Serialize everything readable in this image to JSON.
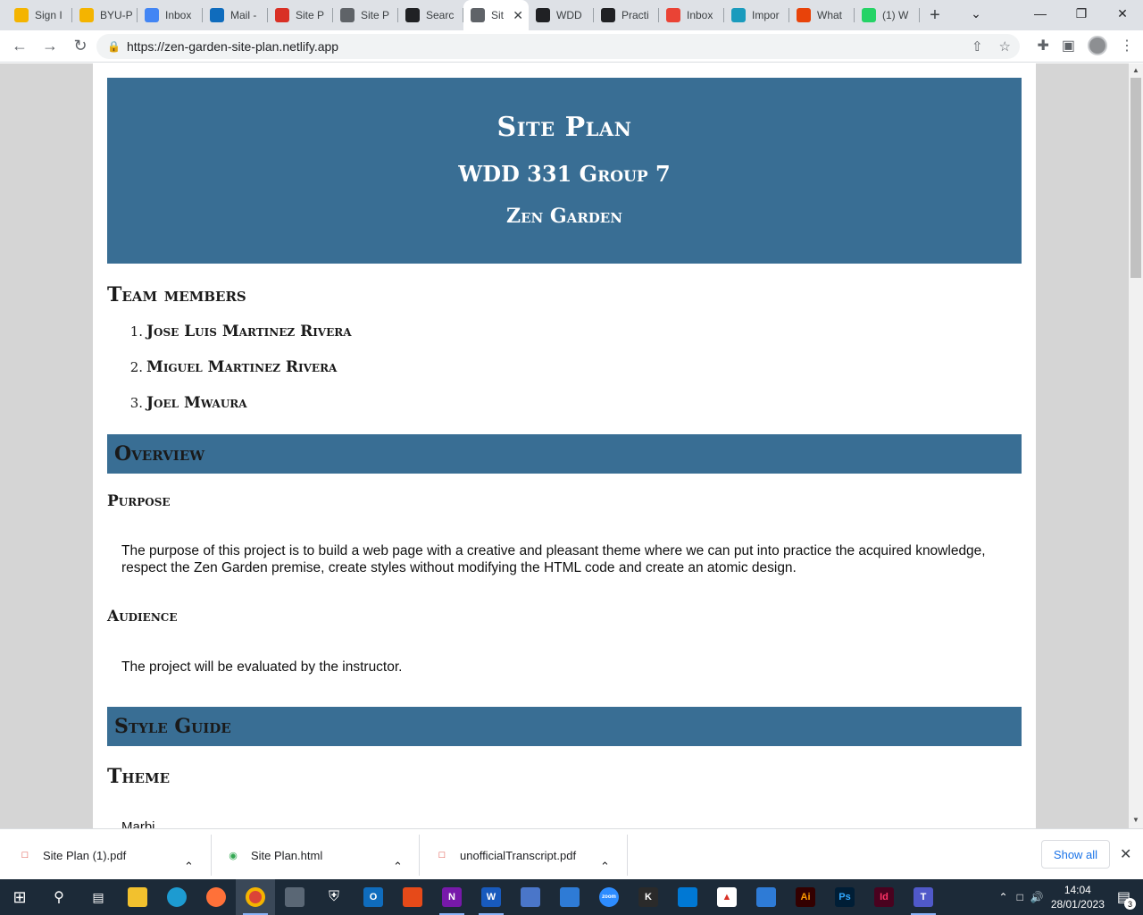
{
  "browser": {
    "tabs": [
      {
        "label": "Sign I",
        "icon": "sign-in-icon",
        "color": "#f4b400"
      },
      {
        "label": "BYU-P",
        "icon": "byu-icon",
        "color": "#f4b400"
      },
      {
        "label": "Inbox",
        "icon": "inbox-icon",
        "color": "#4285f4"
      },
      {
        "label": "Mail -",
        "icon": "outlook-icon",
        "color": "#0f6cbd"
      },
      {
        "label": "Site P",
        "icon": "pdf-icon",
        "color": "#d93025"
      },
      {
        "label": "Site P",
        "icon": "globe-icon",
        "color": "#5f6368"
      },
      {
        "label": "Searc",
        "icon": "github-icon",
        "color": "#202124"
      },
      {
        "label": "Sit",
        "icon": "globe-icon",
        "color": "#5f6368",
        "active": true
      },
      {
        "label": "WDD",
        "icon": "github-icon",
        "color": "#202124"
      },
      {
        "label": "Practi",
        "icon": "github-icon",
        "color": "#202124"
      },
      {
        "label": "Inbox",
        "icon": "gmail-icon",
        "color": "#ea4335"
      },
      {
        "label": "Impor",
        "icon": "diamond-icon",
        "color": "#1a9bbd"
      },
      {
        "label": "What",
        "icon": "alert-icon",
        "color": "#e8430a"
      },
      {
        "label": "(1) W",
        "icon": "whatsapp-icon",
        "color": "#25d366"
      }
    ],
    "url": "https://zen-garden-site-plan.netlify.app"
  },
  "site": {
    "title": "Site Plan",
    "subtitle": "WDD 331 Group 7",
    "project": "Zen Garden",
    "team_heading": "Team members",
    "team": [
      {
        "num": "1.",
        "name": "Jose Luis Martinez Rivera"
      },
      {
        "num": "2.",
        "name": "Miguel Martinez Rivera"
      },
      {
        "num": "3.",
        "name": "Joel Mwaura"
      }
    ],
    "overview_heading": "Overview",
    "purpose_heading": "Purpose",
    "purpose_text": "The purpose of this project is to build a web page with a creative and pleasant theme where we can put into practice the acquired knowledge, respect the Zen Garden premise, create styles without modifying the HTML code and create an atomic design.",
    "audience_heading": "Audience",
    "audience_text": "The project will be evaluated by the instructor.",
    "style_heading": "Style Guide",
    "theme_heading": "Theme",
    "cut_text": "Marbi..."
  },
  "downloads": {
    "items": [
      "Site Plan (1).pdf",
      "Site Plan.html",
      "unofficialTranscript.pdf"
    ],
    "show_all": "Show all"
  },
  "taskbar": {
    "time": "14:04",
    "date": "28/01/2023",
    "notifications": "3"
  }
}
